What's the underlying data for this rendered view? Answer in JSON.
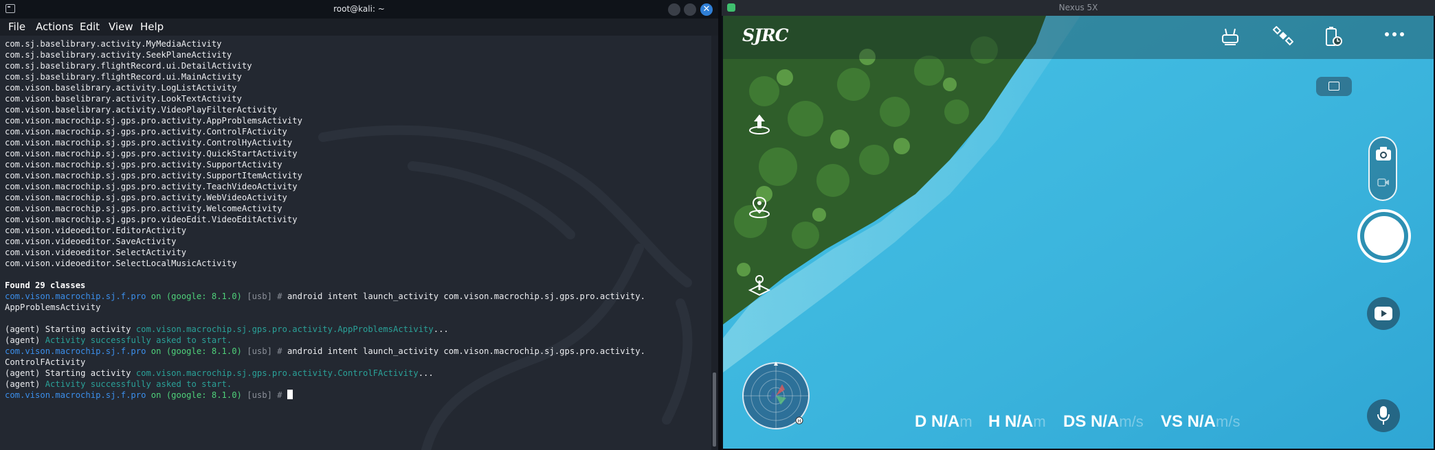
{
  "terminal": {
    "title": "root@kali: ~",
    "menu": [
      "File",
      "Actions",
      "Edit",
      "View",
      "Help"
    ],
    "class_list": [
      "com.sj.baselibrary.activity.MyMediaActivity",
      "com.sj.baselibrary.activity.SeekPlaneActivity",
      "com.sj.baselibrary.flightRecord.ui.DetailActivity",
      "com.sj.baselibrary.flightRecord.ui.MainActivity",
      "com.vison.baselibrary.activity.LogListActivity",
      "com.vison.baselibrary.activity.LookTextActivity",
      "com.vison.baselibrary.activity.VideoPlayFilterActivity",
      "com.vison.macrochip.sj.gps.pro.activity.AppProblemsActivity",
      "com.vison.macrochip.sj.gps.pro.activity.ControlFActivity",
      "com.vison.macrochip.sj.gps.pro.activity.ControlHyActivity",
      "com.vison.macrochip.sj.gps.pro.activity.QuickStartActivity",
      "com.vison.macrochip.sj.gps.pro.activity.SupportActivity",
      "com.vison.macrochip.sj.gps.pro.activity.SupportItemActivity",
      "com.vison.macrochip.sj.gps.pro.activity.TeachVideoActivity",
      "com.vison.macrochip.sj.gps.pro.activity.WebVideoActivity",
      "com.vison.macrochip.sj.gps.pro.activity.WelcomeActivity",
      "com.vison.macrochip.sj.gps.pro.videoEdit.VideoEditActivity",
      "com.vison.videoeditor.EditorActivity",
      "com.vison.videoeditor.SaveActivity",
      "com.vison.videoeditor.SelectActivity",
      "com.vison.videoeditor.SelectLocalMusicActivity"
    ],
    "found_text": "Found 29 classes",
    "prompt": {
      "package": "com.vison.macrochip.sj.f.pro",
      "on": "on",
      "device": "(google: 8.1.0)",
      "conn": "[usb]",
      "sym": "#"
    },
    "cmd1": "android intent launch_activity com.vison.macrochip.sj.gps.pro.activity.",
    "cmd1_cont": "AppProblemsActivity",
    "agent_prefix": "(agent)",
    "starting_text": "Starting activity",
    "activity1": "com.vison.macrochip.sj.gps.pro.activity.AppProblemsActivity",
    "ellipsis": "...",
    "success_text": "Activity successfully asked to start.",
    "cmd2": "android intent launch_activity com.vison.macrochip.sj.gps.pro.activity.",
    "cmd2_cont": "ControlFActivity",
    "activity2": "com.vison.macrochip.sj.gps.pro.activity.ControlFActivity"
  },
  "emulator": {
    "title": "Nexus 5X",
    "logo": "SJRC",
    "telemetry": [
      {
        "label": "D N/A",
        "unit": "m"
      },
      {
        "label": "H N/A",
        "unit": "m"
      },
      {
        "label": "DS N/A",
        "unit": "m/s"
      },
      {
        "label": "VS N/A",
        "unit": "m/s"
      }
    ]
  },
  "colors": {
    "prompt_blue": "#3b8eea",
    "prompt_green": "#4fd17a",
    "agent_teal": "#2aa198",
    "water": "#3db6de",
    "forest": "#2f5e2a"
  }
}
